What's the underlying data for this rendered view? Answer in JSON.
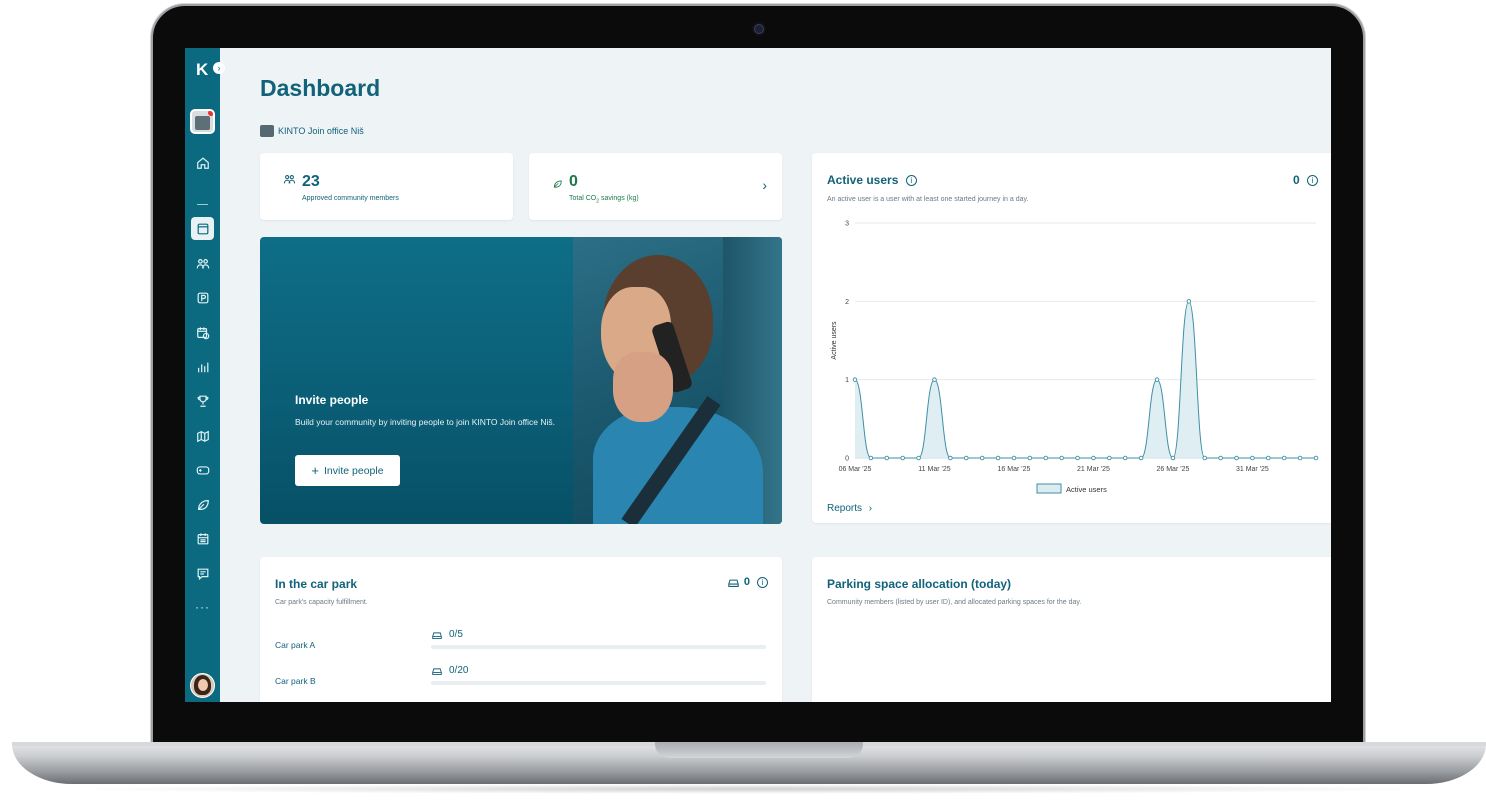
{
  "app": {
    "logo": "K",
    "collapse_icon": "chevron-right-icon"
  },
  "sidebar": {
    "items": [
      {
        "name": "home",
        "icon": "home-icon"
      },
      {
        "name": "dashboard",
        "icon": "dashboard-icon",
        "active": true
      },
      {
        "name": "community",
        "icon": "users-icon"
      },
      {
        "name": "parking",
        "icon": "parking-icon"
      },
      {
        "name": "calendar",
        "icon": "calendar-clock-icon"
      },
      {
        "name": "reports",
        "icon": "bar-chart-icon"
      },
      {
        "name": "rewards",
        "icon": "trophy-icon"
      },
      {
        "name": "map",
        "icon": "map-icon"
      },
      {
        "name": "games",
        "icon": "gamepad-icon"
      },
      {
        "name": "sustainability",
        "icon": "leaf-icon"
      },
      {
        "name": "schedule",
        "icon": "calendar-icon"
      },
      {
        "name": "feedback",
        "icon": "chat-icon"
      }
    ],
    "more": "···"
  },
  "page": {
    "title": "Dashboard",
    "community_name": "KINTO Join office Niš"
  },
  "stats": {
    "members": {
      "value": "23",
      "label": "Approved community members"
    },
    "co2": {
      "value": "0",
      "label_prefix": "Total CO",
      "label_sub": "2",
      "label_suffix": " savings (kg)",
      "chevron": "›"
    }
  },
  "invite": {
    "title": "Invite people",
    "text": "Build your community by inviting people to join KINTO Join office Niš.",
    "button_icon": "+",
    "button_label": "Invite people"
  },
  "active_users": {
    "title": "Active users",
    "info_glyph": "i",
    "value": "0",
    "subtitle": "An active user is a user with at least one started journey in a day.",
    "reports_label": "Reports",
    "reports_chevron": "›"
  },
  "chart_data": {
    "type": "area",
    "title": "Active users",
    "ylabel": "Active users",
    "xlabel": "",
    "ylim": [
      0,
      3
    ],
    "yticks": [
      0,
      1,
      2,
      3
    ],
    "x": [
      "06 Mar '25",
      "07 Mar '25",
      "08 Mar '25",
      "09 Mar '25",
      "10 Mar '25",
      "11 Mar '25",
      "12 Mar '25",
      "13 Mar '25",
      "14 Mar '25",
      "15 Mar '25",
      "16 Mar '25",
      "17 Mar '25",
      "18 Mar '25",
      "19 Mar '25",
      "20 Mar '25",
      "21 Mar '25",
      "22 Mar '25",
      "23 Mar '25",
      "24 Mar '25",
      "25 Mar '25",
      "26 Mar '25",
      "27 Mar '25",
      "28 Mar '25",
      "29 Mar '25",
      "30 Mar '25",
      "31 Mar '25",
      "01 Apr '25",
      "02 Apr '25",
      "03 Apr '25",
      "04 Apr '25"
    ],
    "xtick_labels": [
      "06 Mar '25",
      "11 Mar '25",
      "16 Mar '25",
      "21 Mar '25",
      "26 Mar '25",
      "31 Mar '25"
    ],
    "series": [
      {
        "name": "Active users",
        "values": [
          1,
          0,
          0,
          0,
          0,
          1,
          0,
          0,
          0,
          0,
          0,
          0,
          0,
          0,
          0,
          0,
          0,
          0,
          0,
          1,
          0,
          2,
          0,
          0,
          0,
          0,
          0,
          0,
          0,
          0
        ]
      }
    ],
    "legend": "bottom-center",
    "grid": true,
    "colors": {
      "line": "#3e8fa6",
      "fill": "#dcecf1"
    }
  },
  "car_park": {
    "title": "In the car park",
    "subtitle": "Car park's capacity fulfillment.",
    "total": "0",
    "info_glyph": "i",
    "rows": [
      {
        "name": "Car park A",
        "value": "0/5",
        "fraction": 0
      },
      {
        "name": "Car park B",
        "value": "0/20",
        "fraction": 0
      }
    ]
  },
  "allocation": {
    "title": "Parking space allocation (today)",
    "subtitle": "Community members (listed by user ID), and allocated parking spaces for the day."
  },
  "colors": {
    "brand": "#0b6a80",
    "text": "#11627a",
    "green": "#1c7a4a",
    "background": "#eef3f5"
  }
}
